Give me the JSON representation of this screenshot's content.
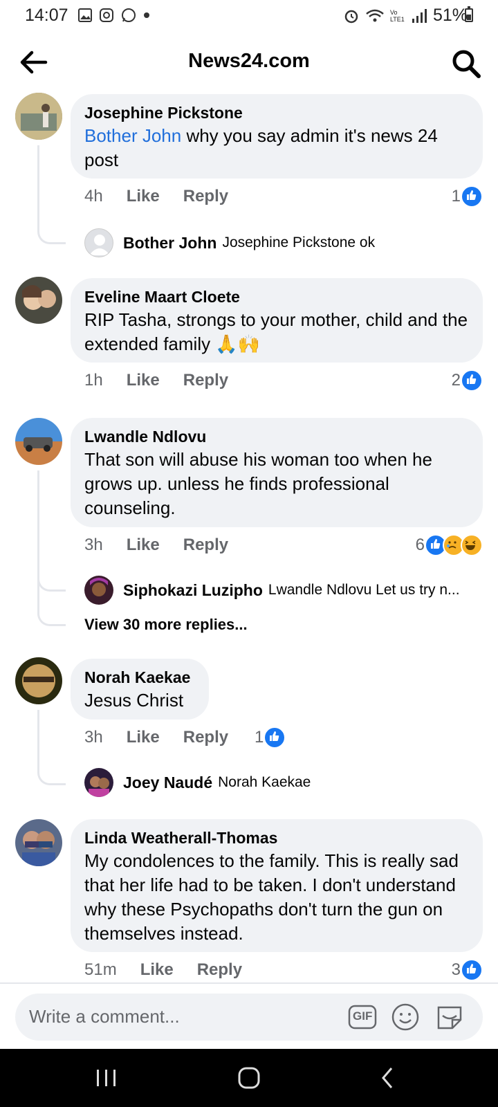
{
  "status": {
    "time": "14:07",
    "battery": "51%",
    "network": "Vo LTE1"
  },
  "header": {
    "title": "News24.com"
  },
  "comments": [
    {
      "name": "Josephine Pickstone",
      "mention": "Bother John",
      "text": " why you say admin it's news 24 post",
      "time": "4h",
      "like": "Like",
      "reply": "Reply",
      "reactions": "1",
      "replies": [
        {
          "name": "Bother John",
          "text": "Josephine Pickstone ok"
        }
      ]
    },
    {
      "name": "Eveline Maart Cloete",
      "text": "RIP Tasha, strongs to your mother, child and the extended family 🙏🙌",
      "time": "1h",
      "like": "Like",
      "reply": "Reply",
      "reactions": "2"
    },
    {
      "name": "Lwandle Ndlovu",
      "text": "That son will abuse his woman too when he grows up. unless he finds professional counseling.",
      "time": "3h",
      "like": "Like",
      "reply": "Reply",
      "reactions": "6",
      "replies": [
        {
          "name": "Siphokazi Luzipho",
          "text": "Lwandle Ndlovu Let us try n..."
        }
      ],
      "more_replies": "View 30 more replies..."
    },
    {
      "name": "Norah Kaekae",
      "text": "Jesus Christ",
      "time": "3h",
      "like": "Like",
      "reply": "Reply",
      "reactions": "1",
      "replies": [
        {
          "name": "Joey Naudé",
          "text": "Norah Kaekae"
        }
      ]
    },
    {
      "name": "Linda Weatherall-Thomas",
      "text": "My condolences to the family. This is really sad that her life had to be taken. I don't understand why these Psychopaths don't turn the gun on themselves instead.",
      "time": "51m",
      "like": "Like",
      "reply": "Reply",
      "reactions": "3"
    }
  ],
  "composer": {
    "placeholder": "Write a comment...",
    "gif_label": "GIF"
  },
  "colors": {
    "accent": "#1877f2",
    "mention": "#216fdb",
    "bubble": "#f0f2f5",
    "meta": "#65676b"
  }
}
